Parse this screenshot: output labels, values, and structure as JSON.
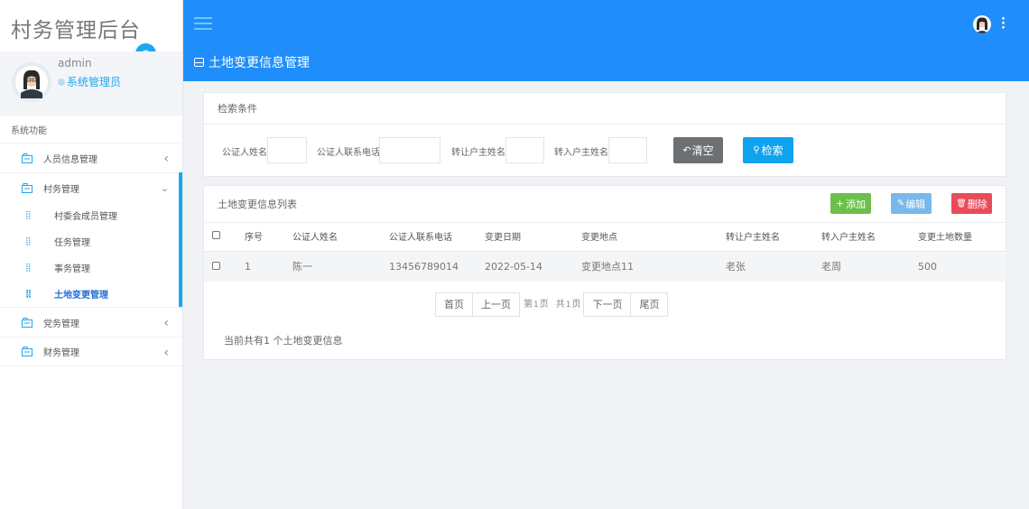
{
  "app": {
    "brand": "村务管理后台"
  },
  "user": {
    "name": "admin",
    "role": "系统管理员"
  },
  "sidebar": {
    "section": "系统功能",
    "items": [
      {
        "label": "人员信息管理"
      },
      {
        "label": "村务管理"
      },
      {
        "label": "党务管理"
      },
      {
        "label": "财务管理"
      }
    ],
    "subitems": [
      {
        "label": "村委会成员管理"
      },
      {
        "label": "任务管理"
      },
      {
        "label": "事务管理"
      },
      {
        "label": "土地变更管理"
      }
    ]
  },
  "header": {
    "title": "土地变更信息管理"
  },
  "search": {
    "title": "检索条件",
    "fields": [
      {
        "label": "公证人姓名",
        "value": ""
      },
      {
        "label": "公证人联系电话",
        "value": ""
      },
      {
        "label": "转让户主姓名",
        "value": ""
      },
      {
        "label": "转入户主姓名",
        "value": ""
      }
    ],
    "clear_label": "清空",
    "search_label": "检索"
  },
  "list": {
    "title": "土地变更信息列表",
    "add_label": "添加",
    "edit_label": "编辑",
    "delete_label": "删除",
    "columns": [
      "序号",
      "公证人姓名",
      "公证人联系电话",
      "变更日期",
      "变更地点",
      "转让户主姓名",
      "转入户主姓名",
      "变更土地数量"
    ],
    "rows": [
      [
        "1",
        "陈一",
        "13456789014",
        "2022-05-14",
        "变更地点11",
        "老张",
        "老周",
        "500"
      ]
    ]
  },
  "pagination": {
    "first": "首页",
    "prev": "上一页",
    "page_prefix": "第",
    "page_num": "1",
    "page_suffix": "页",
    "total_prefix": "共",
    "total_num": "1",
    "total_suffix": "页",
    "next": "下一页",
    "last": "尾页"
  },
  "summary": {
    "prefix": "当前共有",
    "count": "1",
    "suffix": " 个土地变更信息"
  },
  "colors": {
    "accent": "#1f8efa",
    "clear": "#6c7073",
    "search": "#10a3f0",
    "add": "#6cc04a",
    "edit": "#79b8ea",
    "delete": "#ea4b5b"
  }
}
